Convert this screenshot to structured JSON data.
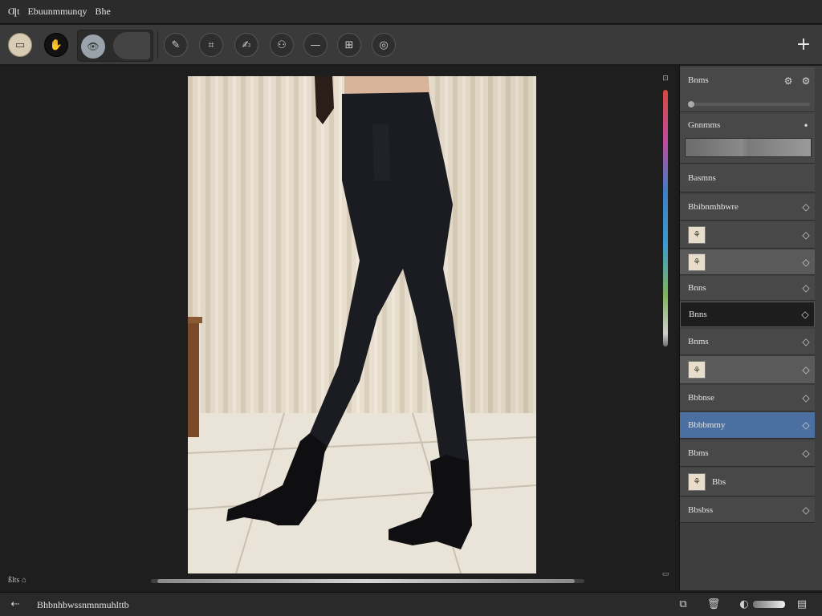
{
  "titlebar": {
    "app_icon_label": "Ƣt",
    "menu_file": "Ebuunmmunqy",
    "menu_edit": "Bhe"
  },
  "toolbar": {
    "tools": [
      {
        "name": "frame-icon",
        "glyph": "▭"
      },
      {
        "name": "hand-icon",
        "glyph": "✋"
      },
      {
        "name": "eye-icon",
        "glyph": "👁"
      },
      {
        "name": "pen-icon",
        "glyph": "✎"
      },
      {
        "name": "crop-icon",
        "glyph": "⌗"
      },
      {
        "name": "brush-icon",
        "glyph": "✍"
      },
      {
        "name": "portrait-icon",
        "glyph": "⚇"
      },
      {
        "name": "line-icon",
        "glyph": "—"
      },
      {
        "name": "grid-icon",
        "glyph": "⊞"
      },
      {
        "name": "target-icon",
        "glyph": "◎"
      }
    ],
    "add_glyph": "+"
  },
  "canvas": {
    "zoom_label": "ßlts ⌂",
    "scroll_position": 0.5
  },
  "panel": {
    "header_label": "Bnms",
    "fill_label": "Gnnmms",
    "section_label": "Basmns",
    "layers": [
      {
        "label": "Bbibnmhbwre",
        "thumb": false,
        "state": "normal"
      },
      {
        "label": "",
        "thumb": true,
        "state": "normal"
      },
      {
        "label": "",
        "thumb": true,
        "state": "hl"
      },
      {
        "label": "Bnns",
        "thumb": false,
        "state": "normal"
      },
      {
        "label": "Bnns",
        "thumb": false,
        "state": "dark"
      },
      {
        "label": "Bnms",
        "thumb": false,
        "state": "normal"
      },
      {
        "label": "",
        "thumb": true,
        "state": "hl"
      },
      {
        "label": "Bbbnse",
        "thumb": false,
        "state": "normal"
      },
      {
        "label": "Bbbbmmy",
        "thumb": false,
        "state": "sel"
      },
      {
        "label": "Bbms",
        "thumb": false,
        "state": "normal"
      },
      {
        "label": "Bbs",
        "thumb": true,
        "state": "normal"
      },
      {
        "label": "Bbsbss",
        "thumb": false,
        "state": "normal"
      }
    ]
  },
  "status": {
    "text": "Bhbnhbwssnmnmuhlttb"
  },
  "colors": {
    "selected_row": "#4a6fa0",
    "background": "#1e1e1e",
    "panel": "#3e3e3e"
  }
}
